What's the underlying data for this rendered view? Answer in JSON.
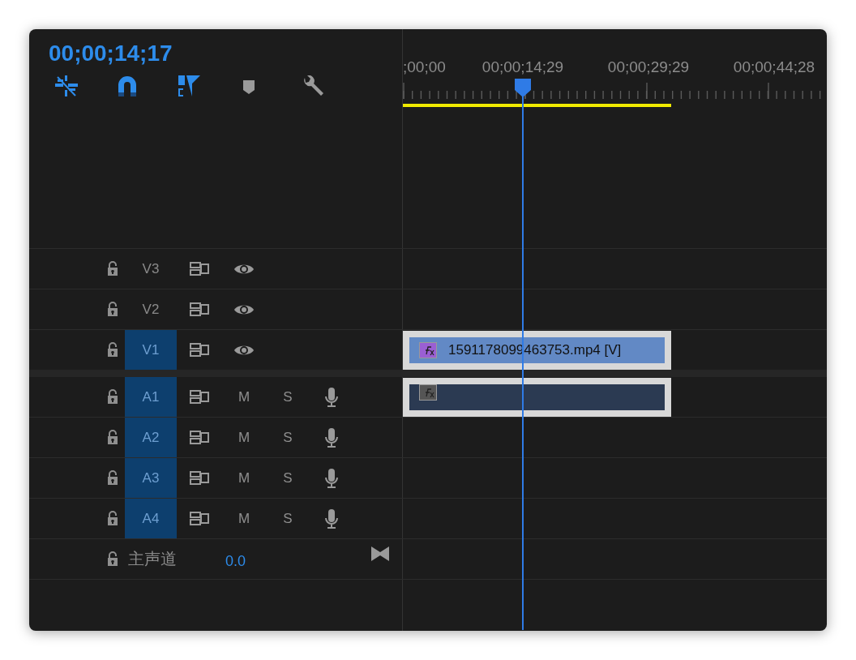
{
  "timecode": "00;00;14;17",
  "toolbar": [
    {
      "kind": "snap",
      "on": true
    },
    {
      "kind": "magnet",
      "on": true
    },
    {
      "kind": "linked",
      "on": true
    },
    {
      "kind": "marker",
      "on": false
    },
    {
      "kind": "wrench",
      "on": false
    }
  ],
  "ruler": {
    "labels": [
      ";00;00",
      "00;00;14;29",
      "00;00;29;29",
      "00;00;44;28"
    ]
  },
  "video_tracks": [
    {
      "name": "V3",
      "targeted": false
    },
    {
      "name": "V2",
      "targeted": false
    },
    {
      "name": "V1",
      "targeted": true,
      "clip": {
        "kind": "video",
        "label": "1591178099463753.mp4 [V]"
      }
    }
  ],
  "audio_tracks": [
    {
      "name": "A1",
      "targeted": true,
      "mute": "M",
      "solo": "S",
      "clip": {
        "kind": "audio"
      }
    },
    {
      "name": "A2",
      "targeted": true,
      "mute": "M",
      "solo": "S"
    },
    {
      "name": "A3",
      "targeted": true,
      "mute": "M",
      "solo": "S"
    },
    {
      "name": "A4",
      "targeted": true,
      "mute": "M",
      "solo": "S"
    }
  ],
  "master": {
    "label": "主声道",
    "value": "0.0"
  }
}
